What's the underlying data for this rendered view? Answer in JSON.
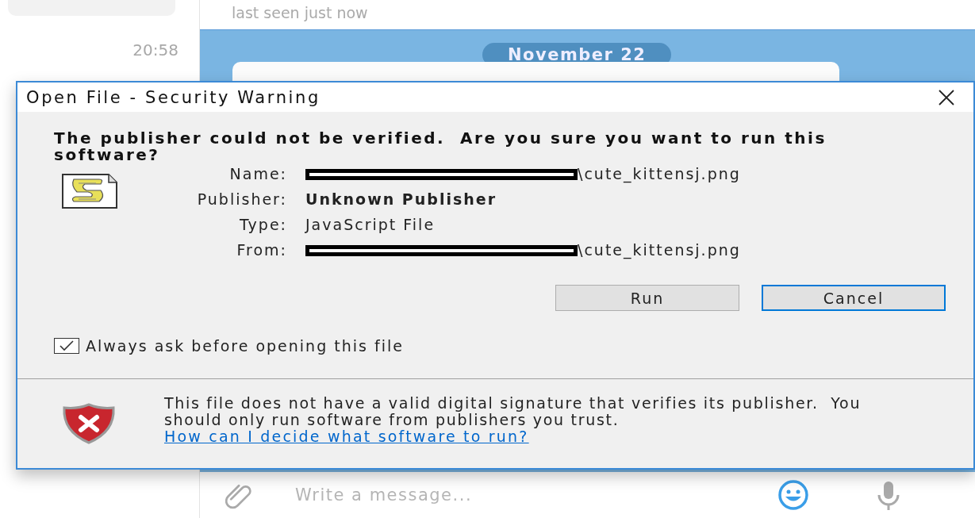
{
  "chat": {
    "status": "last seen just now",
    "sidebar_time": "20:58",
    "date_badge": "November 22",
    "composer": {
      "placeholder": "Write a message..."
    }
  },
  "dialog": {
    "title": "Open File - Security Warning",
    "heading": "The publisher could not be verified.  Are you sure you want to run this software?",
    "fields": [
      {
        "label": "Name:",
        "value": "\\cute_kittensj.png",
        "redacted": true,
        "bold": false
      },
      {
        "label": "Publisher:",
        "value": "Unknown Publisher",
        "redacted": false,
        "bold": true
      },
      {
        "label": "Type:",
        "value": "JavaScript File",
        "redacted": false,
        "bold": false
      },
      {
        "label": "From:",
        "value": "\\cute_kittensj.png",
        "redacted": true,
        "bold": false
      }
    ],
    "buttons": [
      {
        "label": "Run",
        "default": false
      },
      {
        "label": "Cancel",
        "default": true
      }
    ],
    "checkbox": {
      "label": "Always ask before opening this file",
      "checked": true
    },
    "warning": "This file does not have a valid digital signature that verifies its publisher.  You should only run software from publishers you trust.",
    "link": "How can I decide what software to run?"
  }
}
